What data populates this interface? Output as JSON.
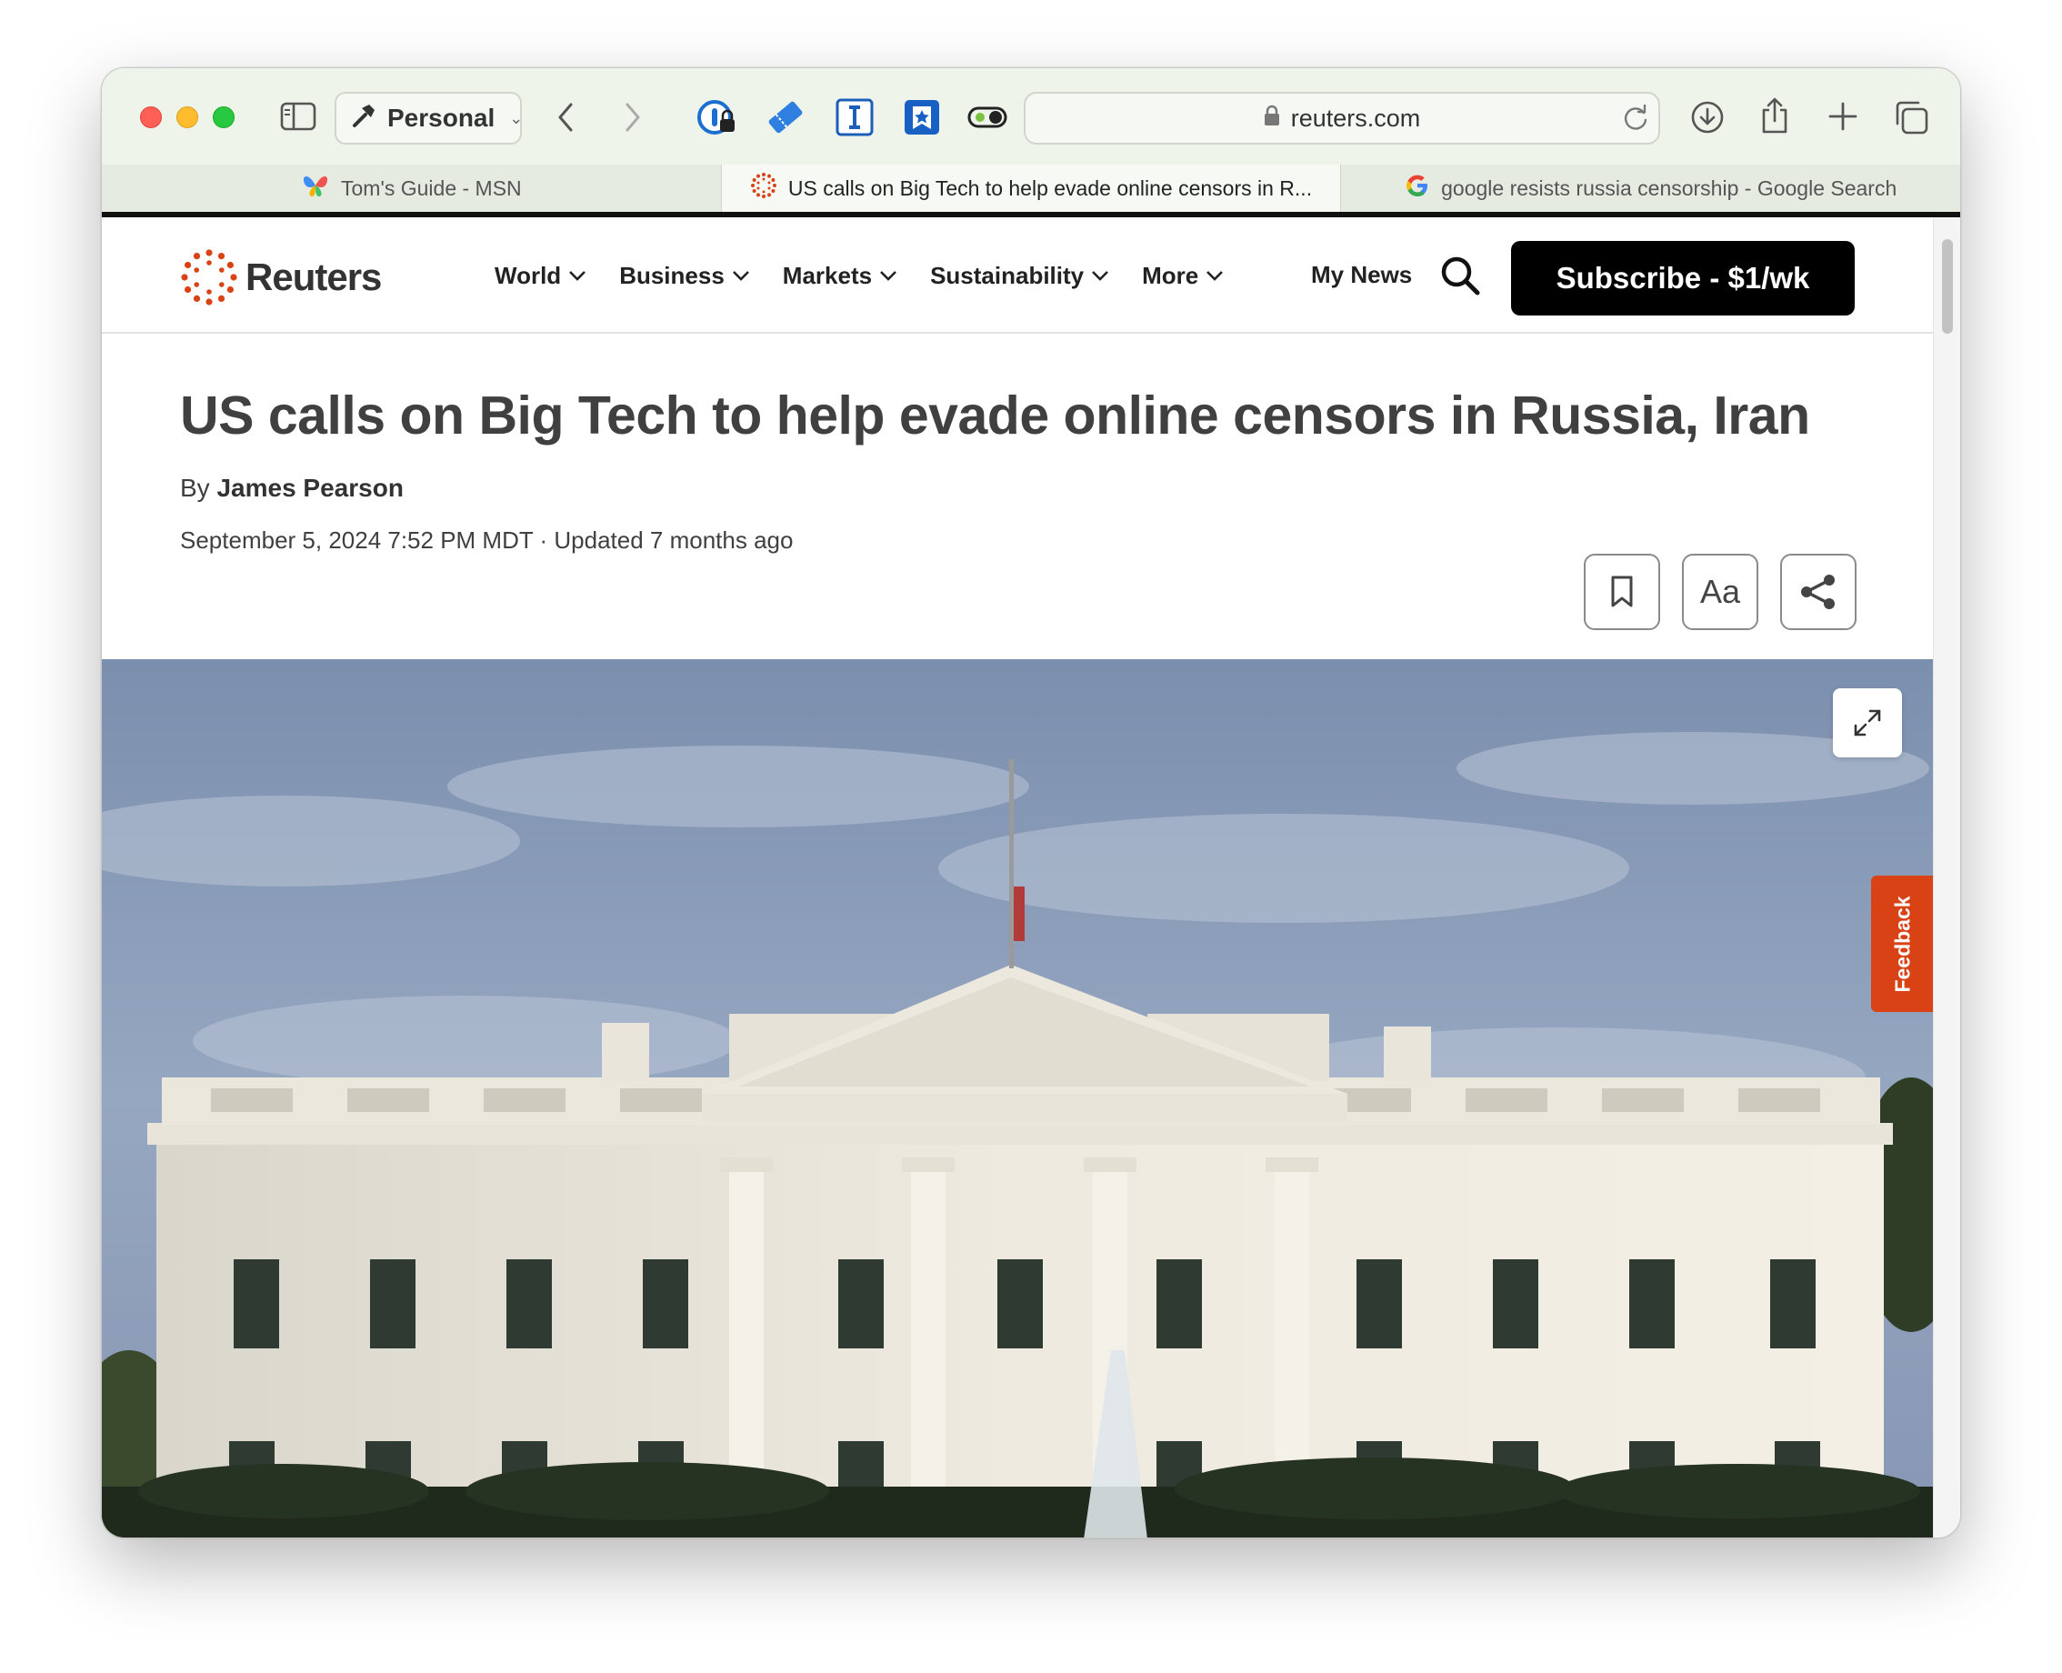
{
  "browser": {
    "profile_label": "Personal",
    "address": "reuters.com",
    "tabs": [
      {
        "title": "Tom's Guide - MSN",
        "icon": "msn-butterfly-icon"
      },
      {
        "title": "US calls on Big Tech to help evade online censors in R...",
        "icon": "reuters-logo-icon"
      },
      {
        "title": "google resists russia censorship - Google Search",
        "icon": "google-g-icon"
      }
    ]
  },
  "site": {
    "logo_text": "Reuters",
    "nav": [
      "World",
      "Business",
      "Markets",
      "Sustainability",
      "More"
    ],
    "my_news": "My News",
    "subscribe": "Subscribe - $1/wk"
  },
  "article": {
    "headline": "US calls on Big Tech to help evade online censors in Russia, Iran",
    "byline_prefix": "By",
    "author": "James Pearson",
    "dateline": "September 5, 2024 7:52 PM MDT · Updated 7 months ago",
    "text_size_label": "Aa",
    "feedback_label": "Feedback"
  },
  "colors": {
    "reuters_orange": "#d84215",
    "toolbar_bg": "#eef4ea",
    "subscribe_bg": "#000000"
  }
}
